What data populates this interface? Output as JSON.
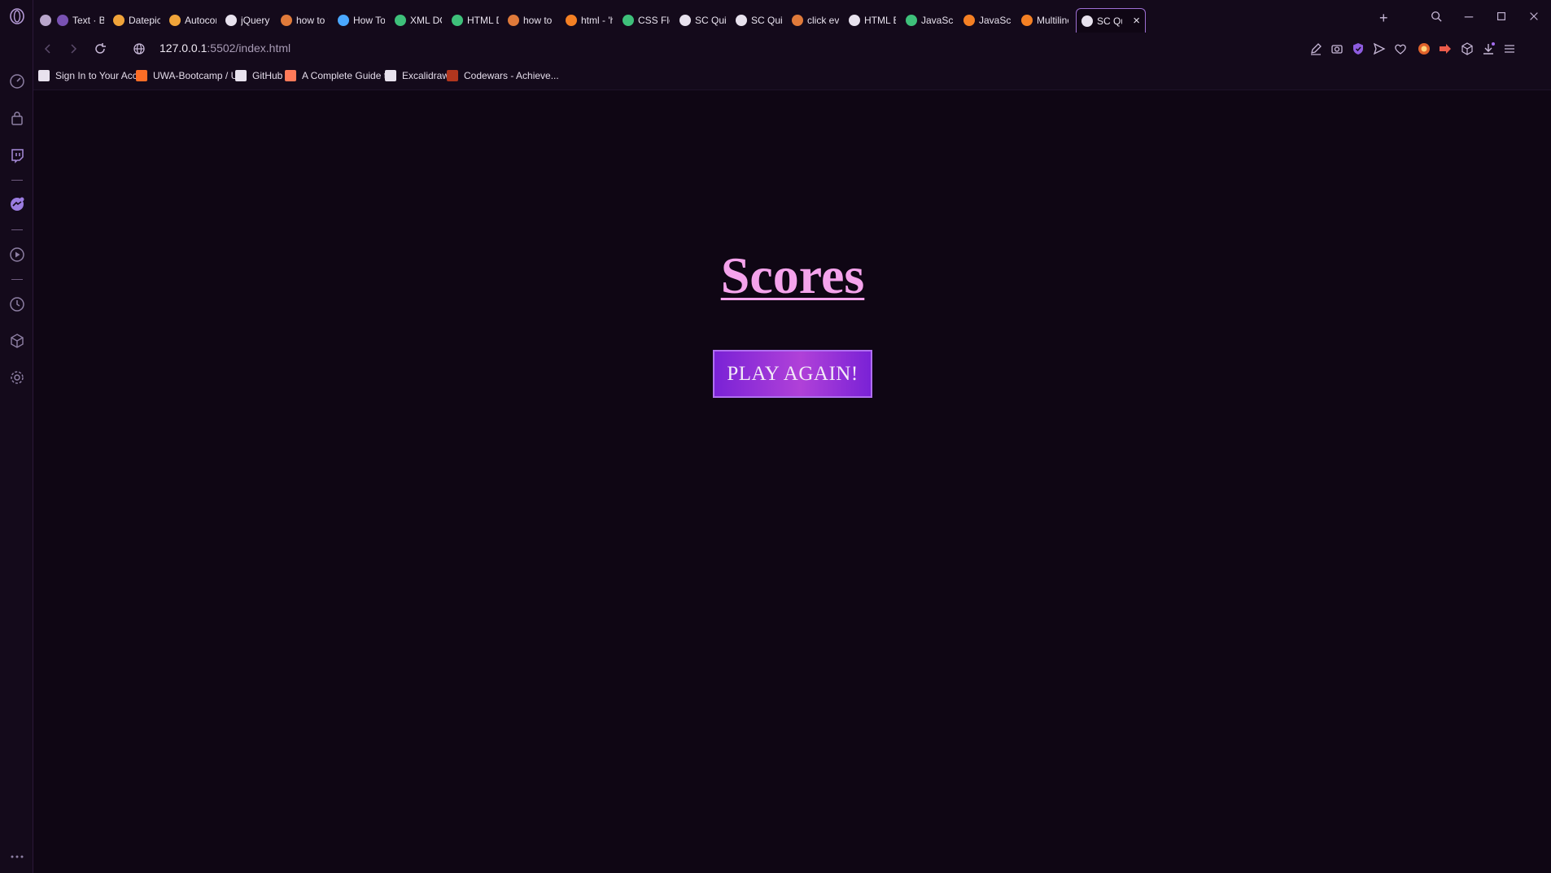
{
  "browser": {
    "tabs": [
      {
        "label": "",
        "icon": "gamepad-icon",
        "color": "#b9a6cc"
      },
      {
        "label": "Text · Boo",
        "icon": "bootstrap-icon",
        "color": "#7952b3"
      },
      {
        "label": "Datepicke",
        "icon": "jquery-ui-icon",
        "color": "#f0a43a"
      },
      {
        "label": "Autocom",
        "icon": "jquery-ui-icon",
        "color": "#f0a43a"
      },
      {
        "label": "jQuery UI",
        "icon": "globe-icon",
        "color": "#e8e2ee"
      },
      {
        "label": "how to tr",
        "icon": "duckduckgo-icon",
        "color": "#e07a3a"
      },
      {
        "label": "How To T",
        "icon": "refresh-icon",
        "color": "#4aa8ff"
      },
      {
        "label": "XML DOM",
        "icon": "w3schools-icon",
        "color": "#3ec07a"
      },
      {
        "label": "HTML DO",
        "icon": "w3schools-icon",
        "color": "#3ec07a"
      },
      {
        "label": "how to m",
        "icon": "duckduckgo-icon",
        "color": "#e07a3a"
      },
      {
        "label": "html - 'hi",
        "icon": "stackoverflow-icon",
        "color": "#f48024"
      },
      {
        "label": "CSS Flexb",
        "icon": "w3schools-icon",
        "color": "#3ec07a"
      },
      {
        "label": "SC Quiz",
        "icon": "globe-icon",
        "color": "#e8e2ee"
      },
      {
        "label": "SC Quiz",
        "icon": "globe-icon",
        "color": "#e8e2ee"
      },
      {
        "label": "click even",
        "icon": "duckduckgo-icon",
        "color": "#e07a3a"
      },
      {
        "label": "HTML Bu",
        "icon": "mdn-icon",
        "color": "#e8e2ee"
      },
      {
        "label": "JavaScrip",
        "icon": "w3schools-icon",
        "color": "#3ec07a"
      },
      {
        "label": "JavaScrip",
        "icon": "stackoverflow-icon",
        "color": "#f48024"
      },
      {
        "label": "Multiline",
        "icon": "stackoverflow-icon",
        "color": "#f48024"
      },
      {
        "label": "SC Qu",
        "icon": "globe-icon",
        "color": "#e8e2ee",
        "active": true
      }
    ],
    "address": {
      "host": "127.0.0.1",
      "rest": ":5502/index.html"
    },
    "bookmarks": [
      {
        "label": "Sign In to Your Acc...",
        "icon": "document-icon",
        "color": "#e8e2ee"
      },
      {
        "label": "UWA-Bootcamp / U...",
        "icon": "gitlab-icon",
        "color": "#fc6d26"
      },
      {
        "label": "GitHub",
        "icon": "github-icon",
        "color": "#e8e2ee"
      },
      {
        "label": "A Complete Guide t...",
        "icon": "css-tricks-icon",
        "color": "#ff7a59"
      },
      {
        "label": "Excalidraw",
        "icon": "excalidraw-icon",
        "color": "#e8e2ee"
      },
      {
        "label": "Codewars - Achieve...",
        "icon": "codewars-icon",
        "color": "#b1361e"
      }
    ]
  },
  "page": {
    "title": "Scores",
    "play_again_label": "PLAY AGAIN!"
  },
  "colors": {
    "accent": "#9d6fd4",
    "title": "#f5a3ec",
    "button": "#8a2be2"
  }
}
